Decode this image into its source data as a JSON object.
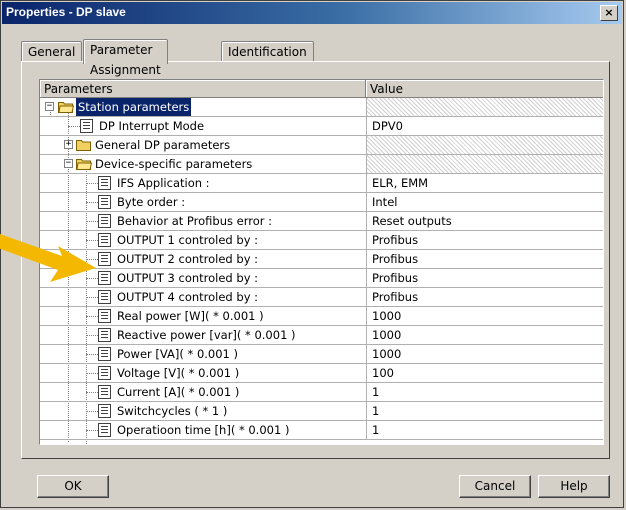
{
  "window": {
    "title": "Properties - DP slave",
    "close_label": "×"
  },
  "tabs": [
    {
      "label": "General"
    },
    {
      "label": "Parameter Assignment",
      "active": true
    },
    {
      "label": "Identification"
    }
  ],
  "grid": {
    "col_parameters": "Parameters",
    "col_value": "Value",
    "rows": [
      {
        "label": "Station parameters",
        "value": "",
        "selected": true
      },
      {
        "label": "DP Interrupt Mode",
        "value": "DPV0"
      },
      {
        "label": "General DP parameters",
        "value": ""
      },
      {
        "label": "Device-specific parameters",
        "value": ""
      },
      {
        "label": "IFS Application :",
        "value": "ELR, EMM"
      },
      {
        "label": "Byte order :",
        "value": "Intel"
      },
      {
        "label": "Behavior at Profibus error :",
        "value": "Reset outputs"
      },
      {
        "label": "OUTPUT 1 controled by :",
        "value": "Profibus"
      },
      {
        "label": "OUTPUT 2 controled by :",
        "value": "Profibus"
      },
      {
        "label": "OUTPUT 3 controled by :",
        "value": "Profibus"
      },
      {
        "label": "OUTPUT 4 controled by :",
        "value": "Profibus"
      },
      {
        "label": "Real power [W]( * 0.001 )",
        "value": "1000"
      },
      {
        "label": "Reactive power [var]( * 0.001 )",
        "value": "1000"
      },
      {
        "label": "Power [VA]( * 0.001 )",
        "value": "1000"
      },
      {
        "label": "Voltage [V]( * 0.001 )",
        "value": "100"
      },
      {
        "label": "Current [A]( * 0.001 )",
        "value": "1"
      },
      {
        "label": "Switchcycles ( * 1 )",
        "value": "1"
      },
      {
        "label": "Operatioon time [h]( * 0.001 )",
        "value": "1"
      }
    ]
  },
  "buttons": {
    "ok": "OK",
    "cancel": "Cancel",
    "help": "Help"
  },
  "colors": {
    "title_bar": "#0a246a",
    "annotation_arrow": "#f5b800"
  }
}
